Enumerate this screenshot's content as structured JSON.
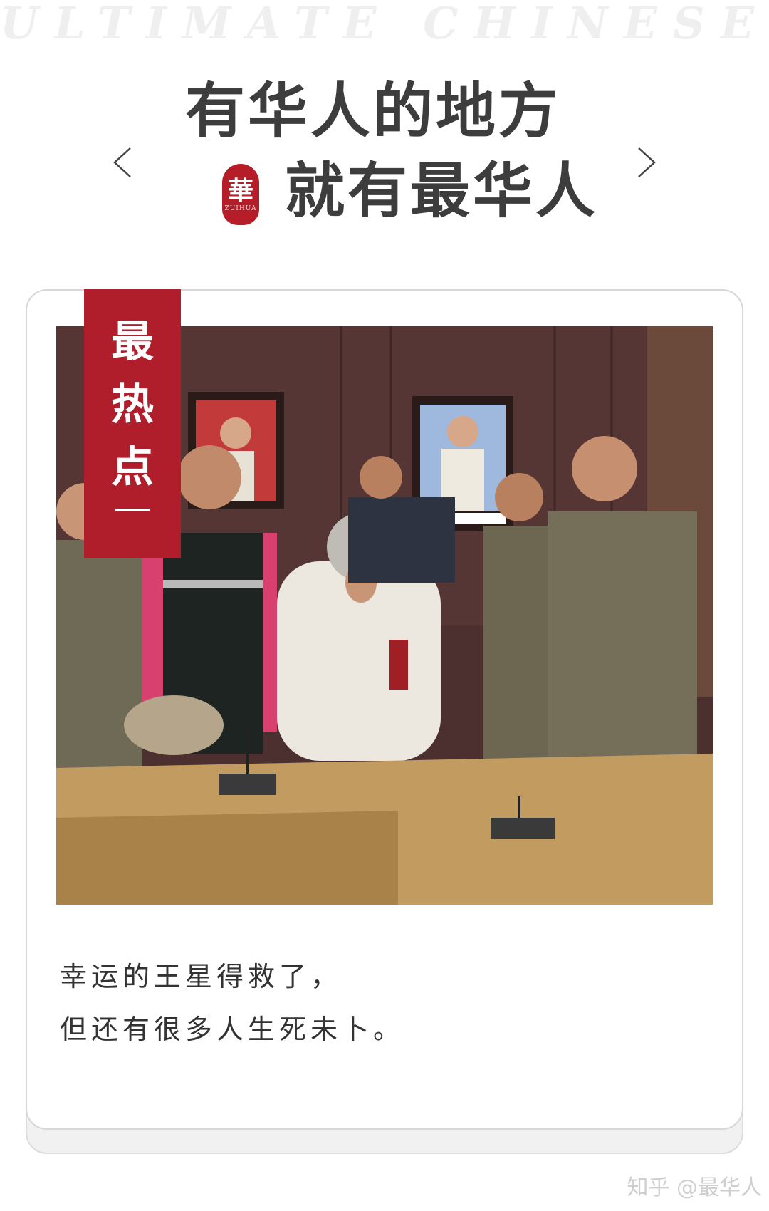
{
  "header": {
    "watermark": "ULTIMATE CHINESE",
    "headline_line1": "有华人的地方",
    "headline_line2": "就有最华人",
    "seal_char": "華",
    "seal_small": "ZUIHUA"
  },
  "nav": {
    "prev_icon": "chevron-left-icon",
    "next_icon": "chevron-right-icon"
  },
  "card": {
    "ribbon_chars": [
      "最",
      "热",
      "点"
    ],
    "photo_alt": "泰国警方会议室中，一名身穿白色衣服的男子双手合十鞠躬致谢，身旁站着多名警察",
    "caption_line1": "幸运的王星得救了，",
    "caption_line2": "但还有很多人生死未卜。"
  },
  "footer": {
    "credit": "知乎 @最华人"
  },
  "colors": {
    "accent_red": "#b11e2b",
    "headline_gray": "#3d3d3d",
    "watermark_gray": "#efefef"
  }
}
